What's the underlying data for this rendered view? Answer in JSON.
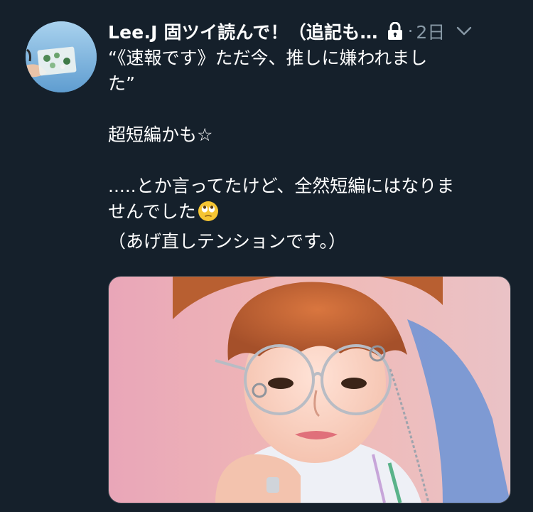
{
  "tweet": {
    "author_name": "Lee.J 固ツイ読んで！（追記も…",
    "separator": "·",
    "time": "2日",
    "lines": [
      "“《速報です》ただ今、推しに嫌われまし",
      "た”",
      "",
      "超短編かも☆",
      "",
      ".....とか言ってたけど、全然短編にはなりま",
      "せんでした",
      "（あげ直しテンションです。）"
    ]
  },
  "icons": {
    "lock": "lock-icon",
    "more": "chevron-down-icon",
    "emoji": "face-with-rolling-eyes-emoji"
  },
  "colors": {
    "background": "#15202b",
    "text": "#ffffff",
    "secondary": "#8899a6",
    "border": "#38444d"
  }
}
